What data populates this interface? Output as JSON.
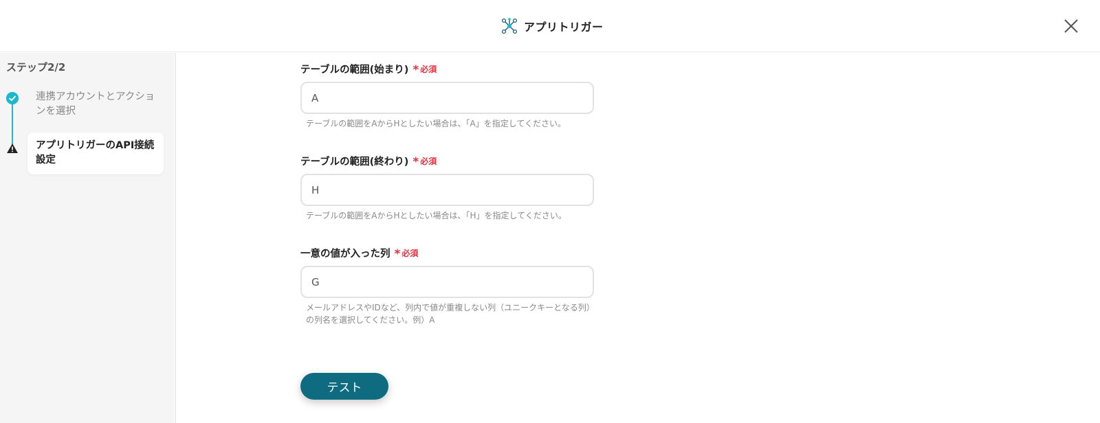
{
  "header": {
    "title": "アプリトリガー",
    "app_icon": "network-nodes-icon",
    "close_icon": "close-icon"
  },
  "sidebar": {
    "step_count": "ステップ2/2",
    "steps": [
      {
        "label": "連携アカウントとアクションを選択",
        "status": "done",
        "icon": "check-circle-icon"
      },
      {
        "label": "アプリトリガーのAPI接続設定",
        "status": "current",
        "icon": "warning-icon"
      }
    ]
  },
  "form": {
    "required_label": "必須",
    "fields": [
      {
        "label": "テーブルの範囲(始まり)",
        "value": "A",
        "help": "テーブルの範囲をAからHとしたい場合は、「A」を指定してください。"
      },
      {
        "label": "テーブルの範囲(終わり)",
        "value": "H",
        "help": "テーブルの範囲をAからHとしたい場合は、「H」を指定してください。"
      },
      {
        "label": "一意の値が入った列",
        "value": "G",
        "help": "メールアドレスやIDなど、列内で値が重複しない列（ユニークキーとなる列）の列名を選択してください。例）A"
      }
    ],
    "test_button": "テスト"
  },
  "colors": {
    "accent": "#1bb8cf",
    "button": "#0e6b80",
    "required": "#e5313f"
  }
}
